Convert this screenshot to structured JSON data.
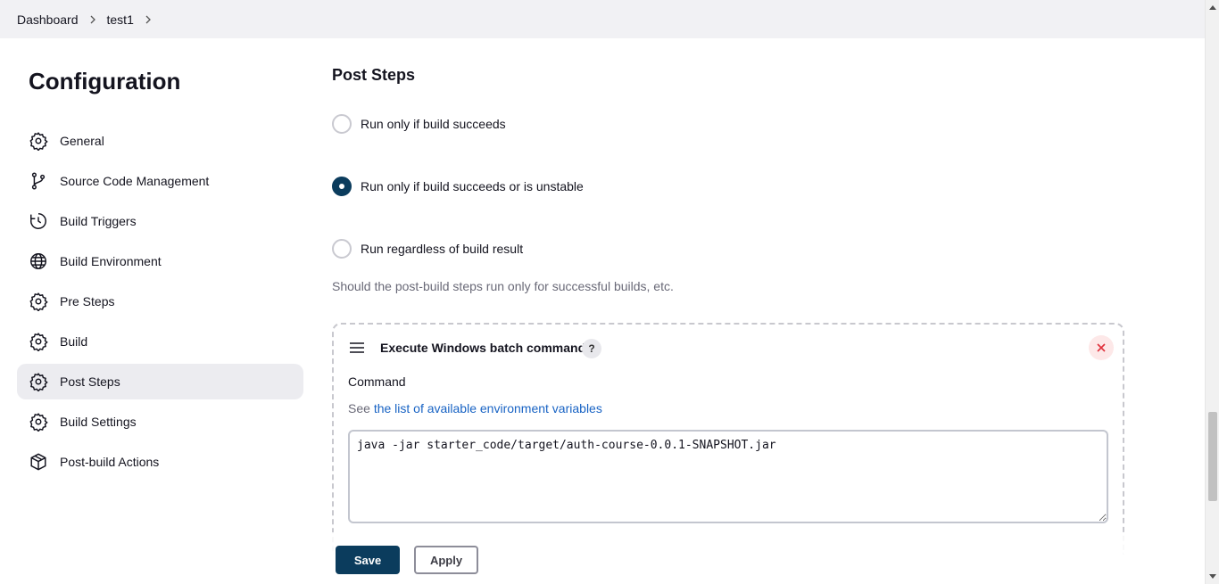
{
  "breadcrumb": {
    "items": [
      {
        "label": "Dashboard"
      },
      {
        "label": "test1"
      }
    ]
  },
  "sidebar": {
    "title": "Configuration",
    "items": [
      {
        "label": "General",
        "icon": "gear-icon"
      },
      {
        "label": "Source Code Management",
        "icon": "branch-icon"
      },
      {
        "label": "Build Triggers",
        "icon": "clock-icon"
      },
      {
        "label": "Build Environment",
        "icon": "globe-icon"
      },
      {
        "label": "Pre Steps",
        "icon": "gear-icon"
      },
      {
        "label": "Build",
        "icon": "gear-icon"
      },
      {
        "label": "Post Steps",
        "icon": "gear-icon",
        "active": true
      },
      {
        "label": "Build Settings",
        "icon": "gear-icon"
      },
      {
        "label": "Post-build Actions",
        "icon": "package-icon"
      }
    ]
  },
  "main": {
    "section_title": "Post Steps",
    "options": [
      {
        "label": "Run only if build succeeds",
        "checked": false
      },
      {
        "label": "Run only if build succeeds or is unstable",
        "checked": true
      },
      {
        "label": "Run regardless of build result",
        "checked": false
      }
    ],
    "help_text": "Should the post-build steps run only for successful builds, etc.",
    "step": {
      "title": "Execute Windows batch command",
      "help_label": "?",
      "field_label": "Command",
      "desc_prefix": "See ",
      "desc_link": "the list of available environment variables",
      "command": "java -jar starter_code/target/auth-course-0.0.1-SNAPSHOT.jar"
    }
  },
  "actions": {
    "save_label": "Save",
    "apply_label": "Apply"
  },
  "colors": {
    "accent": "#0b3c5d",
    "link": "#1863c4",
    "active_nav": "#ececf0",
    "close_bg": "#fde8e8",
    "close_x": "#e0323c"
  }
}
